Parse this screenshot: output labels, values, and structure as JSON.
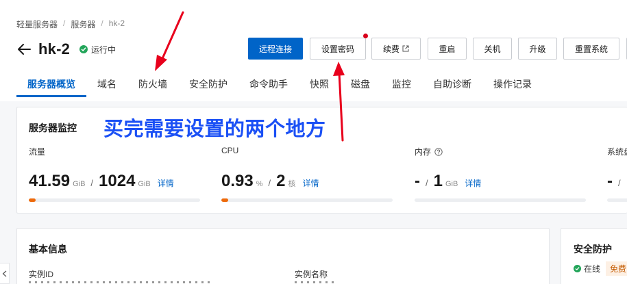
{
  "breadcrumb": [
    "轻量服务器",
    "服务器",
    "hk-2"
  ],
  "header": {
    "title": "hk-2",
    "status": "运行中",
    "back_icon": "arrow-left-icon"
  },
  "actions": {
    "remote_connect": "远程连接",
    "set_password": "设置密码",
    "renew": "续费",
    "restart": "重启",
    "shutdown": "关机",
    "upgrade": "升级",
    "reset_system": "重置系统"
  },
  "tabs": [
    "服务器概览",
    "域名",
    "防火墙",
    "安全防护",
    "命令助手",
    "快照",
    "磁盘",
    "监控",
    "自助诊断",
    "操作记录"
  ],
  "monitor": {
    "title": "服务器监控",
    "annotation": "买完需要设置的两个地方",
    "detail_label": "详情",
    "traffic": {
      "label": "流量",
      "used": "41.59",
      "used_unit": "GiB",
      "slash": "/",
      "total": "1024",
      "total_unit": "GiB",
      "progress": 0.04
    },
    "cpu": {
      "label": "CPU",
      "used": "0.93",
      "used_unit": "%",
      "slash": "/",
      "total": "2",
      "total_unit": "核",
      "progress": 0.0093
    },
    "memory": {
      "label": "内存",
      "used": "-",
      "slash": "/",
      "total": "1",
      "total_unit": "GiB",
      "progress": 0
    },
    "disk": {
      "label": "系统盘",
      "used": "-",
      "slash": "/",
      "progress": 0
    }
  },
  "basic_info": {
    "title": "基本信息",
    "instance_id_label": "实例ID",
    "instance_name_label": "实例名称"
  },
  "security": {
    "title": "安全防护",
    "status": "在线",
    "badge": "免费"
  },
  "colors": {
    "accent": "#0064c8",
    "annotation": "#1b50f5",
    "arrow": "#e8001c",
    "progress": "#ed6a0c",
    "online": "#23a55a"
  }
}
